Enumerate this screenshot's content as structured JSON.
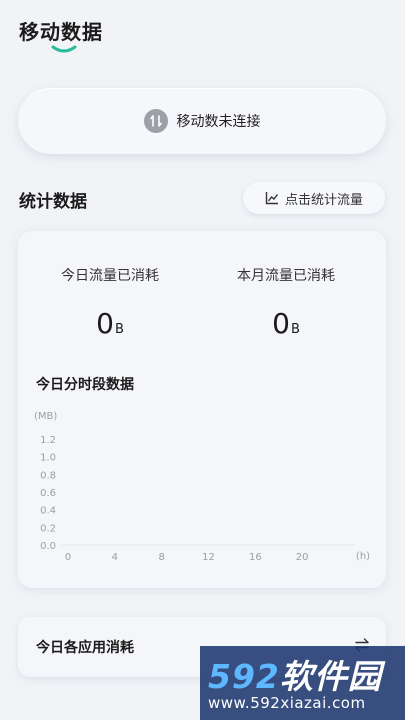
{
  "header": {
    "title": "移动数据"
  },
  "connection": {
    "status_text": "未连接",
    "label": "移动数未连接"
  },
  "stats": {
    "section_title": "统计数据",
    "button_label": "点击统计流量",
    "today_label": "今日流量已消耗",
    "today_value": "0",
    "today_unit": "B",
    "month_label": "本月流量已消耗",
    "month_value": "0",
    "month_unit": "B"
  },
  "chart_data": {
    "type": "line",
    "title": "今日分时段数据",
    "ylabel": "(MB)",
    "xlabel": "(h)",
    "x_ticks": [
      "0",
      "4",
      "8",
      "12",
      "16",
      "20"
    ],
    "y_ticks": [
      "0.0",
      "0.2",
      "0.4",
      "0.6",
      "0.8",
      "1.0",
      "1.2"
    ],
    "ylim": [
      0,
      1.2
    ],
    "xlim": [
      0,
      24
    ],
    "series": []
  },
  "apps": {
    "label": "今日各应用消耗"
  },
  "watermark": {
    "logo_num": "592",
    "logo_text": "软件园",
    "url": "www.592xiazai.com"
  },
  "colors": {
    "accent": "#26b99a",
    "background": "#f1f3f7",
    "icon_gray": "#9da0a6"
  }
}
